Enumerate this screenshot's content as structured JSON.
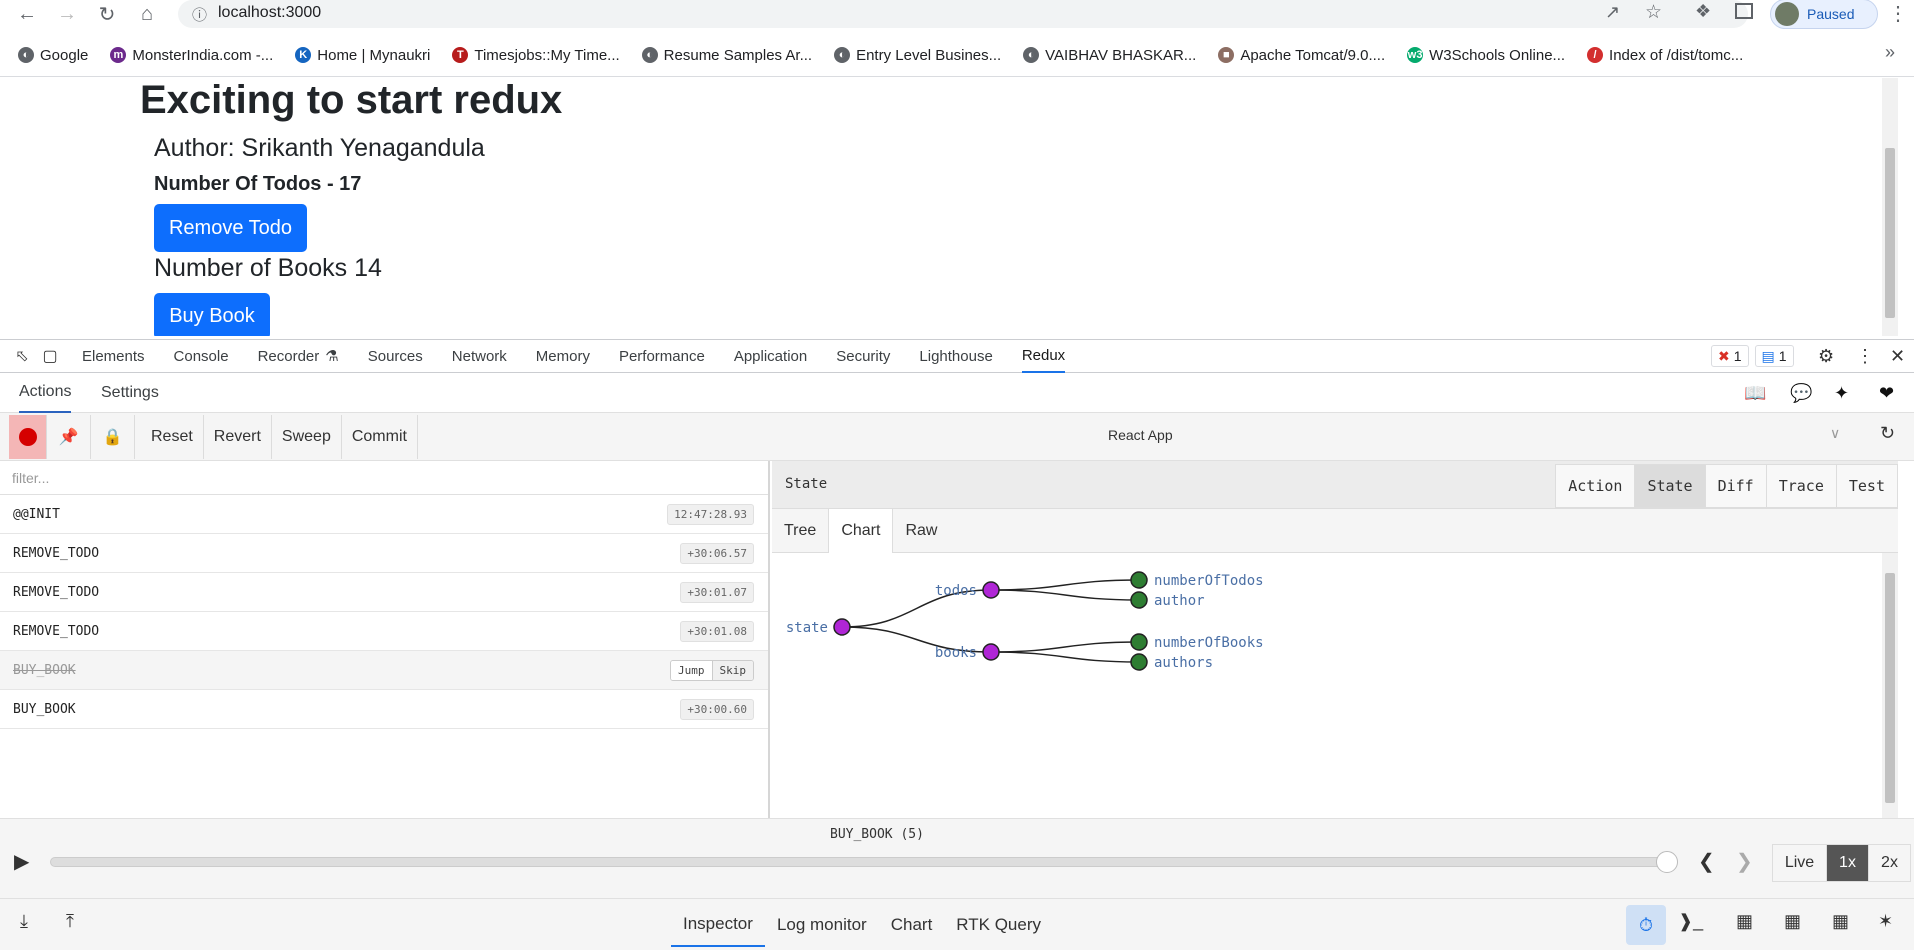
{
  "browser": {
    "url": "localhost:3000",
    "profile_status": "Paused",
    "bookmarks": [
      {
        "label": "Google",
        "color": "#5f6368",
        "glyph": "◐"
      },
      {
        "label": "MonsterIndia.com -...",
        "color": "#6c2a8c",
        "glyph": "m"
      },
      {
        "label": "Home | Mynaukri",
        "color": "#1565c0",
        "glyph": "K"
      },
      {
        "label": "Timesjobs::My Time...",
        "color": "#b71c1c",
        "glyph": "T"
      },
      {
        "label": "Resume Samples Ar...",
        "color": "#5f6368",
        "glyph": "◐"
      },
      {
        "label": "Entry Level Busines...",
        "color": "#5f6368",
        "glyph": "◐"
      },
      {
        "label": "VAIBHAV BHASKAR...",
        "color": "#5f6368",
        "glyph": "◐"
      },
      {
        "label": "Apache Tomcat/9.0....",
        "color": "#8d6e63",
        "glyph": "■"
      },
      {
        "label": "W3Schools Online...",
        "color": "#04aa6d",
        "glyph": "w3"
      },
      {
        "label": "Index of /dist/tomc...",
        "color": "#d32f2f",
        "glyph": "/"
      }
    ],
    "more_glyph": "»"
  },
  "page": {
    "heading": "Exciting to start redux",
    "author": "Author: Srikanth Yenagandula",
    "todos": "Number Of Todos - 17",
    "remove_label": "Remove Todo",
    "books": "Number of Books 14",
    "buy_label": "Buy Book"
  },
  "devtools": {
    "tabs": [
      "Elements",
      "Console",
      "Recorder",
      "Sources",
      "Network",
      "Memory",
      "Performance",
      "Application",
      "Security",
      "Lighthouse",
      "Redux"
    ],
    "active_tab": "Redux",
    "errors": "1",
    "messages": "1"
  },
  "redux": {
    "subtabs": [
      "Actions",
      "Settings"
    ],
    "toolbar": [
      "Reset",
      "Revert",
      "Sweep",
      "Commit"
    ],
    "instance": "React App",
    "filter_placeholder": "filter...",
    "actions": [
      {
        "name": "@@INIT",
        "time": "12:47:28.93",
        "skipped": false
      },
      {
        "name": "REMOVE_TODO",
        "time": "+30:06.57",
        "skipped": false
      },
      {
        "name": "REMOVE_TODO",
        "time": "+30:01.07",
        "skipped": false
      },
      {
        "name": "REMOVE_TODO",
        "time": "+30:01.08",
        "skipped": false
      },
      {
        "name": "BUY_BOOK",
        "time": "",
        "skipped": true
      },
      {
        "name": "BUY_BOOK",
        "time": "+30:00.60",
        "skipped": false
      }
    ],
    "jump_label": "Jump",
    "skip_label": "Skip",
    "state_title": "State",
    "state_tabs": [
      "Action",
      "State",
      "Diff",
      "Trace",
      "Test"
    ],
    "view_tabs": [
      "Tree",
      "Chart",
      "Raw"
    ],
    "tree": {
      "root": "state",
      "children": [
        {
          "name": "todos",
          "leaves": [
            "numberOfTodos",
            "author"
          ]
        },
        {
          "name": "books",
          "leaves": [
            "numberOfBooks",
            "authors"
          ]
        }
      ],
      "colors": {
        "branch": "#b026d6",
        "leaf": "#2e7d32",
        "text": "#4a6fa5"
      }
    },
    "slider": {
      "label": "BUY_BOOK (5)",
      "position": 1.0
    },
    "speeds": [
      "Live",
      "1x",
      "2x"
    ],
    "active_speed": "1x",
    "bottom_tabs": [
      "Inspector",
      "Log monitor",
      "Chart",
      "RTK Query"
    ]
  }
}
